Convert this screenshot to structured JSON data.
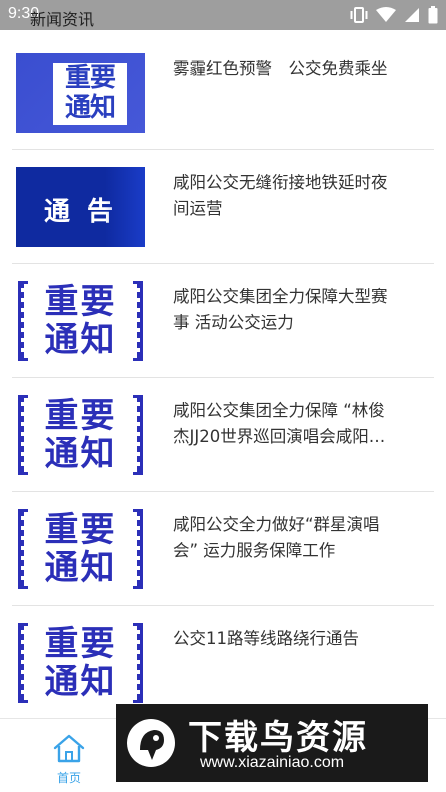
{
  "status_bar": {
    "time": "9:30",
    "title": "新闻资讯"
  },
  "colors": {
    "accent": "#3aa3e8",
    "notice_blue": "#2b2fb8",
    "statusbar": "#9e9e9e"
  },
  "news": [
    {
      "title": "雾霾红色预警　公交免费乘坐",
      "thumb": "notice-blue",
      "thumb_text": [
        "重要",
        "通知"
      ]
    },
    {
      "title": "咸阳公交无缝衔接地铁延时夜间运营",
      "thumb": "gaogao",
      "thumb_text": [
        "通 告"
      ]
    },
    {
      "title": "咸阳公交集团全力保障大型赛事 活动公交运力",
      "thumb": "notice-white",
      "thumb_text": [
        "重要",
        "通知"
      ]
    },
    {
      "title": "咸阳公交集团全力保障 “林俊杰JJ20世界巡回演唱会咸阳站”运力服务保障工作",
      "thumb": "notice-white",
      "thumb_text": [
        "重要",
        "通知"
      ]
    },
    {
      "title": "咸阳公交全力做好“群星演唱会” 运力服务保障工作",
      "thumb": "notice-white",
      "thumb_text": [
        "重要",
        "通知"
      ]
    },
    {
      "title": "公交11路等线路绕行通告",
      "thumb": "notice-white",
      "thumb_text": [
        "重要",
        "通知"
      ]
    }
  ],
  "bottom_nav": {
    "home_label": "首页",
    "home_icon": "home-icon"
  },
  "watermark": {
    "main": "下载鸟资源",
    "url": "www.xiazainiao.com"
  }
}
